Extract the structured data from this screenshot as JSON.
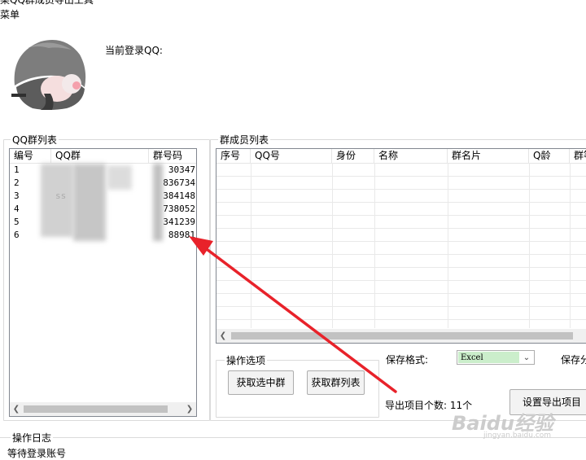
{
  "window": {
    "title": "某QQ群成员导出工具"
  },
  "menu": {
    "label": "菜单"
  },
  "login": {
    "label": "当前登录QQ:"
  },
  "qq_groups": {
    "title": "QQ群列表",
    "columns": [
      "编号",
      "QQ群",
      "群号码"
    ],
    "rows": [
      {
        "id": "1",
        "name": "",
        "number": "30347"
      },
      {
        "id": "2",
        "name": "",
        "number": "836734"
      },
      {
        "id": "3",
        "name": "ss",
        "number": "384148"
      },
      {
        "id": "4",
        "name": "",
        "number": "738052"
      },
      {
        "id": "5",
        "name": "",
        "number": "341239"
      },
      {
        "id": "6",
        "name": "",
        "number": "88981"
      }
    ]
  },
  "members": {
    "title": "群成员列表",
    "columns": [
      "序号",
      "QQ号",
      "身份",
      "名称",
      "群名片",
      "Q龄",
      "群等"
    ]
  },
  "operations": {
    "title": "操作选项",
    "get_selected_label": "获取选中群",
    "get_list_label": "获取群列表"
  },
  "save_format": {
    "label": "保存格式:",
    "value": "Excel",
    "path_label": "保存分"
  },
  "export": {
    "count_label": "导出项目个数: 11个",
    "settings_label": "设置导出项目"
  },
  "log": {
    "title": "操作日志",
    "status": "等待登录账号"
  },
  "watermark": {
    "text": "Baidu经验",
    "url": "jingyan.baidu.com"
  },
  "colors": {
    "arrow": "#e8222a",
    "select_fill": "#cbeecb"
  }
}
